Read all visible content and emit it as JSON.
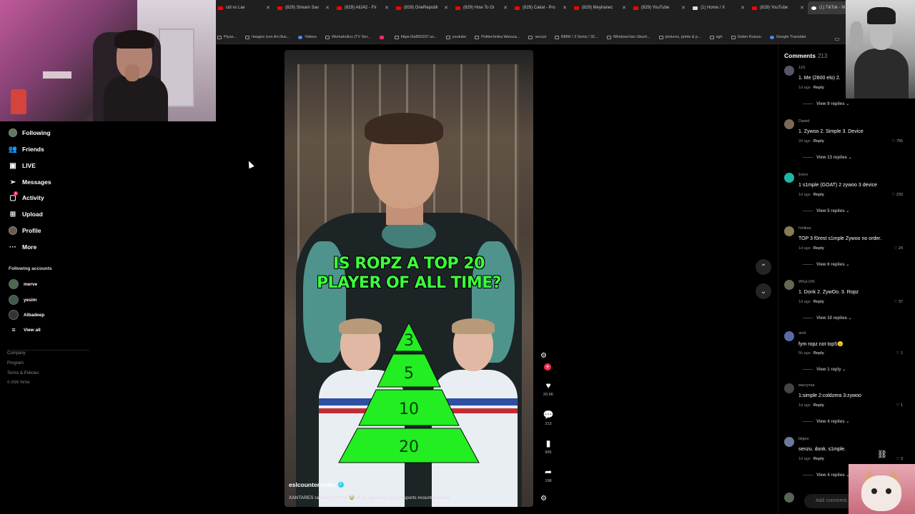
{
  "browser": {
    "tabs": [
      {
        "label": "cid vs Lav",
        "icon": "youtube",
        "active": false
      },
      {
        "label": "(829) Stream Sav",
        "icon": "youtube",
        "active": false
      },
      {
        "label": "(829) Ati242 - Fir",
        "icon": "youtube",
        "active": false
      },
      {
        "label": "(829) OneRepubli",
        "icon": "youtube",
        "active": false
      },
      {
        "label": "(829) How To Gr",
        "icon": "youtube",
        "active": false
      },
      {
        "label": "(829) Cakal - Pro",
        "icon": "youtube",
        "active": false
      },
      {
        "label": "(829) Meyhanec",
        "icon": "youtube",
        "active": false
      },
      {
        "label": "(829) YouTube",
        "icon": "youtube",
        "active": false
      },
      {
        "label": "(1) Home / X",
        "icon": "x",
        "active": false
      },
      {
        "label": "(829) YouTube",
        "icon": "youtube",
        "active": false
      },
      {
        "label": "(1) TikTok - M",
        "icon": "tiktok",
        "active": true
      }
    ],
    "new_tab": "+",
    "bookmarks": [
      {
        "label": "Piyas...",
        "icon": "folder"
      },
      {
        "label": "Images icon An illus...",
        "icon": "page"
      },
      {
        "label": "Videos",
        "icon": "google"
      },
      {
        "label": "Workaholics (TV Ser...",
        "icon": "page"
      },
      {
        "label": "",
        "icon": "instagram"
      },
      {
        "label": "https://ia800207.us...",
        "icon": "page"
      },
      {
        "label": "youtube",
        "icon": "folder"
      },
      {
        "label": "Politechnika Warsza...",
        "icon": "page"
      },
      {
        "label": "secusi",
        "icon": "folder"
      },
      {
        "label": "BMW / 3 Serisi / 32...",
        "icon": "page"
      },
      {
        "label": "Windows'tan Ubunt...",
        "icon": "page"
      },
      {
        "label": "pictures, prints & p...",
        "icon": "page"
      },
      {
        "label": "sgh",
        "icon": "folder"
      },
      {
        "label": "Gelen Kutusu",
        "icon": "page"
      },
      {
        "label": "Google Translate",
        "icon": "google"
      }
    ]
  },
  "sidebar": {
    "nav": [
      {
        "label": "Following",
        "icon": "following-icon"
      },
      {
        "label": "Friends",
        "icon": "friends-icon"
      },
      {
        "label": "LIVE",
        "icon": "live-icon"
      },
      {
        "label": "Messages",
        "icon": "messages-icon"
      },
      {
        "label": "Activity",
        "icon": "activity-icon"
      },
      {
        "label": "Upload",
        "icon": "upload-icon"
      },
      {
        "label": "Profile",
        "icon": "profile-icon"
      },
      {
        "label": "More",
        "icon": "more-icon"
      }
    ],
    "activity_badge": "3",
    "following_title": "Following accounts",
    "accounts": [
      "merve",
      "yesim",
      "Albadeep"
    ],
    "view_all": "View all",
    "footer": [
      "Company",
      "Program",
      "Terms & Policies",
      "© 2026 TikTok"
    ]
  },
  "video": {
    "headline": "IS ROPZ A TOP 20 PLAYER OF ALL TIME?",
    "pyramid_tiers": [
      "3",
      "5",
      "10",
      "20"
    ],
    "author": "eslcounterstrike",
    "caption": "XANTARES ranked CS Pros 🤯 #ESL #gaming #cs2 #esports #counterstrike2",
    "likes": "20.9K",
    "comments": "213",
    "saves": "905",
    "shares": "198"
  },
  "comments_panel": {
    "title": "Comments",
    "count": "213",
    "add_placeholder": "Add comment...",
    "items": [
      {
        "user": "123",
        "text": "1. Me (2800 elo) 2.",
        "time": "1d ago",
        "reply": "Reply",
        "likes": "",
        "views": "View 9 replies"
      },
      {
        "user": "Dawid",
        "text": "1. Zywoo 2. Simple 3. Device",
        "time": "2d ago",
        "reply": "Reply",
        "likes": "755",
        "views": "View 13 replies"
      },
      {
        "user": "Emre",
        "text": "1 s1mple (GOAT) 2 zywoo 3 device",
        "time": "1d ago",
        "reply": "Reply",
        "likes": "233",
        "views": "View 5 replies"
      },
      {
        "user": "iVolkan",
        "text": "TOP 3 f0rest s1mple Zywoo no order.",
        "time": "1d ago",
        "reply": "Reply",
        "likes": "24",
        "views": "View 6 replies"
      },
      {
        "user": "WhyLON",
        "text": "1. Donk 2. ZywOo. 3. Ropz",
        "time": "1d ago",
        "reply": "Reply",
        "likes": "37",
        "views": "View 10 replies"
      },
      {
        "user": "amli",
        "text": "fym ropz not top5😑",
        "time": "5h ago",
        "reply": "Reply",
        "likes": "1",
        "views": "View 1 reply"
      },
      {
        "user": "масгутка",
        "text": "1:simple 2:coldzera 3:zywoo",
        "time": "1d ago",
        "reply": "Reply",
        "likes": "1",
        "views": "View 4 replies"
      },
      {
        "user": "bilgee",
        "text": "senzu. donk. s1mple.",
        "time": "1d ago",
        "reply": "Reply",
        "likes": "3",
        "views": "View 4 replies"
      }
    ]
  },
  "colors": {
    "accent": "#fe2c55",
    "headline_green": "#3cff3c",
    "pyramid_green": "#22ee22",
    "verified": "#20d5ec"
  }
}
